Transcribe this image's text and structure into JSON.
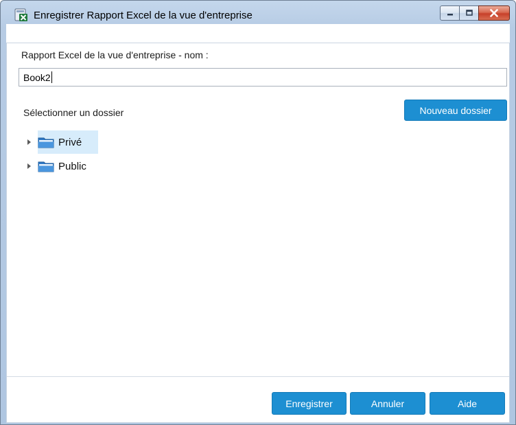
{
  "window": {
    "title": "Enregistrer Rapport Excel de la vue d'entreprise",
    "icon": "excel-report-icon",
    "controls": [
      "minimize-icon",
      "maximize-icon",
      "close-icon"
    ]
  },
  "form": {
    "name_label": "Rapport Excel de la vue d'entreprise - nom :",
    "name_value": "Book2",
    "folder_label": "Sélectionner un dossier",
    "new_folder_button": "Nouveau dossier"
  },
  "tree": {
    "items": [
      {
        "label": "Privé",
        "selected": true,
        "icon": "folder-icon"
      },
      {
        "label": "Public",
        "selected": false,
        "icon": "folder-icon"
      }
    ]
  },
  "footer": {
    "save_button": "Enregistrer",
    "cancel_button": "Annuler",
    "help_button": "Aide"
  },
  "colors": {
    "accent": "#1d8fd2",
    "selection": "#d7ecfb",
    "titlebar": "#b6cbe4",
    "close": "#c7402a"
  }
}
